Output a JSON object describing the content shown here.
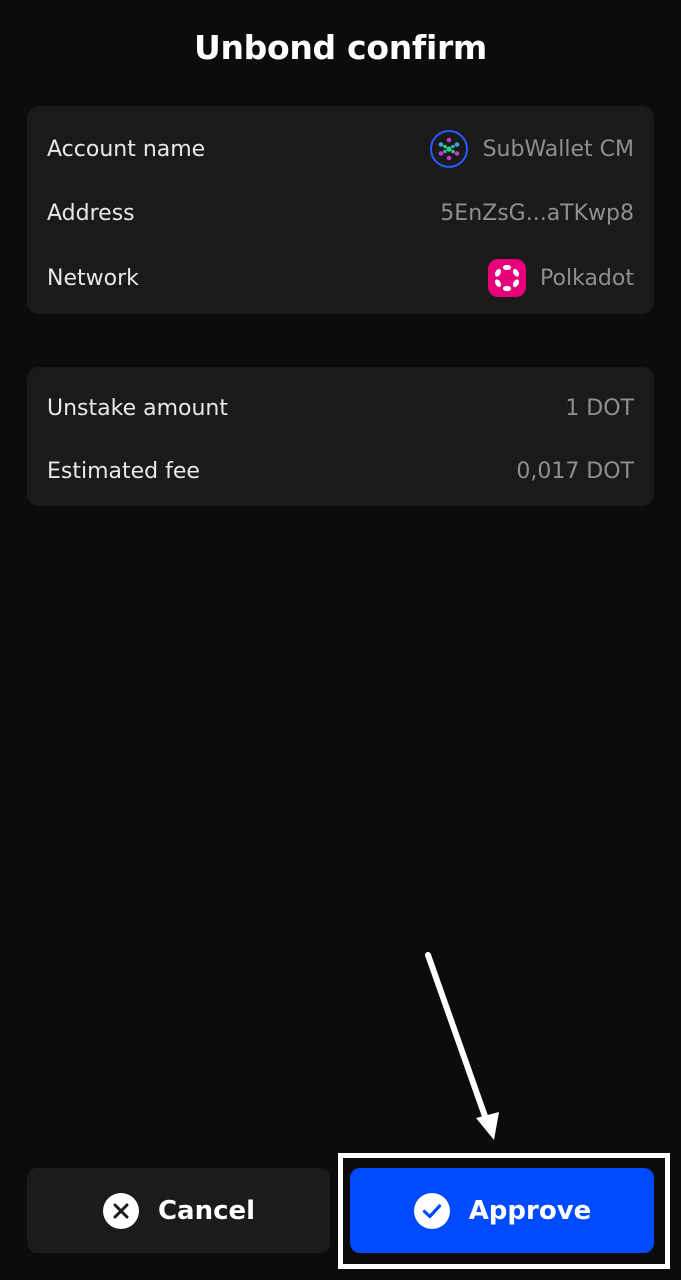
{
  "header": {
    "title": "Unbond confirm"
  },
  "account_card": {
    "account_name_label": "Account name",
    "account_name_value": "SubWallet CM",
    "address_label": "Address",
    "address_value": "5EnZsG...aTKwp8",
    "network_label": "Network",
    "network_value": "Polkadot"
  },
  "amount_card": {
    "unstake_label": "Unstake amount",
    "unstake_value": "1 DOT",
    "fee_label": "Estimated fee",
    "fee_value": "0,017 DOT"
  },
  "footer": {
    "cancel_label": "Cancel",
    "approve_label": "Approve"
  },
  "icons": {
    "account_avatar": "subwallet-avatar-icon",
    "network": "polkadot-icon",
    "cancel": "close-circle-icon",
    "approve": "check-circle-icon"
  },
  "colors": {
    "background": "#0c0c0c",
    "card": "#1a1a1a",
    "approve": "#004bff",
    "polkadot": "#e6007a"
  }
}
